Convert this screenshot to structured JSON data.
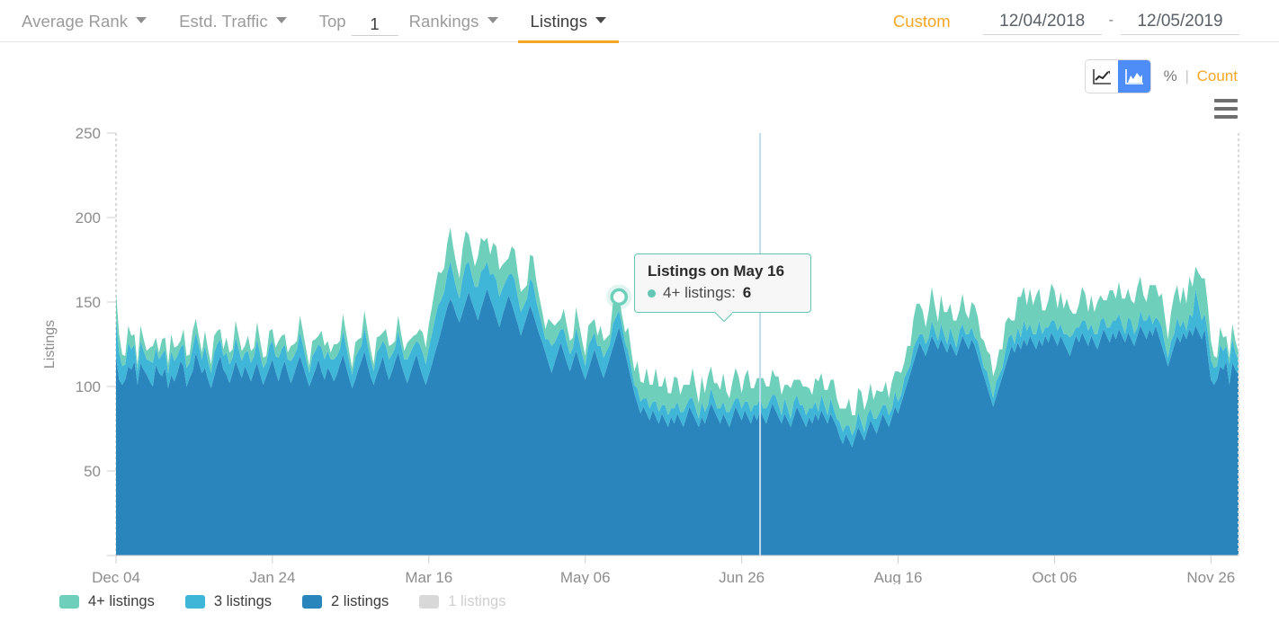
{
  "topbar": {
    "tabs": [
      {
        "label": "Average Rank",
        "active": false
      },
      {
        "label": "Estd. Traffic",
        "active": false
      },
      {
        "label": "Rankings",
        "active": false
      },
      {
        "label": "Listings",
        "active": true
      }
    ],
    "top_prefix": "Top",
    "top_value": "1",
    "custom_label": "Custom",
    "date_start": "12/04/2018",
    "date_separator": "-",
    "date_end": "12/05/2019"
  },
  "controls": {
    "line_icon": "line-chart-icon",
    "area_icon": "area-chart-icon",
    "area_selected": true,
    "percent_label": "%",
    "separator": "|",
    "count_label": "Count",
    "menu_icon": "hamburger-menu-icon"
  },
  "tooltip": {
    "title": "Listings on May 16",
    "series_label": "4+ listings:",
    "value": "6"
  },
  "legend": [
    {
      "label": "4+ listings",
      "color": "#6ecfba",
      "disabled": false
    },
    {
      "label": "3 listings",
      "color": "#3fb5d8",
      "disabled": false
    },
    {
      "label": "2 listings",
      "color": "#2a85bd",
      "disabled": false
    },
    {
      "label": "1 listings",
      "color": "#d8d8d8",
      "disabled": true
    }
  ],
  "chart_data": {
    "type": "area",
    "stacked": true,
    "title": "",
    "xlabel": "",
    "ylabel": "Listings",
    "ylim": [
      0,
      250
    ],
    "yticks": [
      50,
      100,
      150,
      200,
      250
    ],
    "grid": false,
    "legend_position": "bottom-left",
    "x_tick_labels": [
      "Dec 04",
      "Jan 24",
      "Mar 16",
      "May 06",
      "Jun 26",
      "Aug 16",
      "Oct 06",
      "Nov 26"
    ],
    "x_tick_indices": [
      0,
      51,
      102,
      153,
      204,
      255,
      306,
      357
    ],
    "n_points": 367,
    "highlight": {
      "index": 164,
      "label": "May 16",
      "series": "4+ listings",
      "value": 6
    },
    "crosshair_index": 210,
    "series": [
      {
        "name": "2 listings",
        "color": "#2a85bd",
        "values": [
          118,
          104,
          101,
          104,
          112,
          110,
          115,
          101,
          114,
          110,
          107,
          103,
          100,
          113,
          108,
          106,
          111,
          99,
          107,
          103,
          108,
          115,
          112,
          100,
          105,
          109,
          120,
          114,
          108,
          111,
          104,
          99,
          106,
          113,
          118,
          110,
          107,
          102,
          108,
          115,
          110,
          105,
          112,
          108,
          103,
          109,
          114,
          107,
          101,
          106,
          111,
          116,
          109,
          103,
          110,
          115,
          108,
          102,
          107,
          113,
          118,
          112,
          106,
          100,
          105,
          110,
          116,
          109,
          104,
          111,
          108,
          103,
          107,
          113,
          119,
          112,
          105,
          99,
          104,
          110,
          115,
          121,
          113,
          106,
          101,
          107,
          112,
          118,
          110,
          104,
          109,
          115,
          120,
          113,
          107,
          102,
          108,
          114,
          119,
          112,
          106,
          101,
          107,
          113,
          120,
          126,
          133,
          140,
          147,
          152,
          148,
          142,
          138,
          144,
          150,
          156,
          150,
          145,
          139,
          146,
          152,
          158,
          152,
          147,
          141,
          135,
          142,
          148,
          154,
          149,
          143,
          137,
          130,
          136,
          142,
          148,
          143,
          137,
          131,
          126,
          120,
          114,
          108,
          114,
          120,
          126,
          120,
          114,
          109,
          115,
          121,
          115,
          109,
          104,
          110,
          116,
          122,
          116,
          110,
          105,
          111,
          117,
          123,
          129,
          135,
          128,
          120,
          112,
          104,
          96,
          90,
          84,
          88,
          84,
          80,
          86,
          82,
          78,
          84,
          80,
          76,
          82,
          78,
          84,
          80,
          76,
          82,
          88,
          84,
          80,
          76,
          82,
          78,
          84,
          90,
          86,
          82,
          78,
          84,
          80,
          76,
          82,
          88,
          84,
          80,
          86,
          82,
          78,
          84,
          80,
          86,
          82,
          78,
          84,
          90,
          86,
          82,
          78,
          84,
          80,
          76,
          82,
          88,
          84,
          80,
          76,
          82,
          78,
          84,
          80,
          86,
          82,
          78,
          84,
          80,
          76,
          70,
          66,
          72,
          68,
          64,
          70,
          76,
          72,
          68,
          74,
          80,
          76,
          72,
          78,
          84,
          80,
          76,
          82,
          88,
          84,
          90,
          96,
          102,
          108,
          114,
          120,
          126,
          122,
          118,
          124,
          130,
          126,
          122,
          128,
          124,
          120,
          126,
          122,
          118,
          124,
          130,
          126,
          122,
          128,
          124,
          118,
          112,
          106,
          100,
          94,
          88,
          94,
          100,
          106,
          112,
          118,
          124,
          120,
          126,
          122,
          128,
          124,
          130,
          126,
          122,
          128,
          124,
          130,
          126,
          132,
          128,
          124,
          130,
          126,
          122,
          118,
          124,
          130,
          126,
          132,
          128,
          124,
          130,
          126,
          122,
          128,
          134,
          130,
          126,
          132,
          128,
          134,
          130,
          126,
          132,
          128,
          124,
          130,
          136,
          132,
          128,
          134,
          130,
          136,
          130,
          124,
          118,
          112,
          118,
          124,
          130,
          126,
          132,
          128,
          134,
          130,
          136,
          132,
          128,
          134
        ]
      },
      {
        "name": "3 listings",
        "color": "#3fb5d8",
        "values": [
          22,
          16,
          11,
          9,
          14,
          12,
          10,
          8,
          13,
          11,
          9,
          12,
          14,
          10,
          8,
          13,
          11,
          9,
          14,
          12,
          10,
          8,
          13,
          11,
          9,
          14,
          12,
          10,
          8,
          13,
          11,
          9,
          14,
          12,
          10,
          8,
          13,
          11,
          9,
          14,
          12,
          10,
          8,
          13,
          11,
          9,
          14,
          12,
          10,
          8,
          13,
          11,
          9,
          14,
          12,
          10,
          8,
          13,
          11,
          9,
          14,
          12,
          10,
          8,
          13,
          11,
          9,
          14,
          12,
          10,
          8,
          13,
          11,
          9,
          14,
          12,
          10,
          8,
          13,
          11,
          9,
          14,
          12,
          10,
          8,
          13,
          11,
          9,
          14,
          12,
          10,
          8,
          13,
          11,
          9,
          14,
          12,
          10,
          8,
          13,
          14,
          12,
          16,
          18,
          20,
          22,
          18,
          16,
          20,
          22,
          18,
          16,
          14,
          20,
          22,
          18,
          16,
          14,
          20,
          22,
          18,
          16,
          14,
          20,
          22,
          18,
          16,
          14,
          12,
          18,
          20,
          16,
          14,
          12,
          10,
          16,
          18,
          14,
          12,
          10,
          8,
          14,
          16,
          12,
          10,
          8,
          14,
          12,
          10,
          8,
          14,
          12,
          10,
          8,
          14,
          12,
          10,
          8,
          14,
          12,
          10,
          8,
          14,
          12,
          10,
          8,
          6,
          9,
          7,
          5,
          9,
          7,
          5,
          9,
          7,
          5,
          9,
          7,
          5,
          9,
          7,
          5,
          9,
          7,
          5,
          9,
          7,
          5,
          9,
          7,
          5,
          9,
          7,
          5,
          9,
          7,
          5,
          9,
          7,
          5,
          9,
          7,
          5,
          9,
          7,
          5,
          9,
          7,
          5,
          9,
          7,
          5,
          9,
          7,
          5,
          9,
          7,
          5,
          9,
          7,
          5,
          9,
          7,
          5,
          9,
          7,
          5,
          9,
          7,
          5,
          9,
          7,
          5,
          9,
          7,
          5,
          9,
          7,
          5,
          9,
          7,
          5,
          9,
          7,
          5,
          9,
          7,
          5,
          9,
          7,
          5,
          9,
          7,
          5,
          9,
          7,
          5,
          9,
          7,
          5,
          9,
          7,
          5,
          9,
          7,
          5,
          9,
          7,
          5,
          9,
          7,
          5,
          9,
          7,
          5,
          9,
          7,
          5,
          9,
          7,
          5,
          9,
          7,
          5,
          9,
          7,
          5,
          9,
          7,
          5,
          9,
          11,
          7,
          5,
          9,
          7,
          11,
          9,
          7,
          5,
          9,
          11,
          7,
          5,
          9,
          7,
          11,
          9,
          7,
          5,
          9,
          11,
          7,
          5,
          9,
          7,
          11,
          9,
          7,
          5,
          9,
          11,
          7,
          5,
          9,
          7,
          11,
          9,
          7,
          5,
          9,
          11,
          7,
          5,
          9,
          7,
          11,
          9,
          7,
          5,
          9,
          11,
          7,
          5,
          9,
          7,
          11,
          9,
          7,
          5,
          9,
          11
        ]
      },
      {
        "name": "4+ listings",
        "color": "#6ecfba",
        "values": [
          16,
          11,
          7,
          5,
          10,
          8,
          6,
          4,
          9,
          7,
          5,
          8,
          10,
          6,
          4,
          9,
          7,
          5,
          10,
          8,
          6,
          4,
          9,
          7,
          5,
          10,
          8,
          6,
          4,
          9,
          7,
          5,
          10,
          8,
          6,
          4,
          9,
          7,
          5,
          10,
          8,
          6,
          4,
          9,
          7,
          5,
          10,
          8,
          6,
          4,
          9,
          7,
          5,
          10,
          8,
          6,
          4,
          9,
          7,
          5,
          10,
          8,
          6,
          4,
          9,
          7,
          5,
          10,
          8,
          6,
          4,
          9,
          7,
          5,
          10,
          8,
          6,
          4,
          9,
          7,
          5,
          10,
          8,
          6,
          4,
          9,
          7,
          5,
          10,
          8,
          6,
          4,
          9,
          7,
          5,
          10,
          8,
          6,
          4,
          9,
          12,
          10,
          14,
          16,
          18,
          20,
          16,
          14,
          18,
          20,
          16,
          14,
          12,
          18,
          20,
          16,
          14,
          12,
          18,
          20,
          16,
          14,
          12,
          18,
          20,
          16,
          14,
          12,
          10,
          16,
          18,
          14,
          12,
          10,
          8,
          14,
          16,
          12,
          10,
          8,
          6,
          12,
          14,
          10,
          8,
          6,
          12,
          10,
          8,
          6,
          12,
          10,
          8,
          6,
          12,
          10,
          8,
          6,
          12,
          10,
          8,
          6,
          12,
          10,
          8,
          6,
          6,
          14,
          10,
          8,
          16,
          12,
          9,
          18,
          14,
          10,
          20,
          15,
          11,
          17,
          13,
          9,
          19,
          14,
          10,
          16,
          12,
          8,
          18,
          13,
          9,
          15,
          11,
          17,
          13,
          9,
          15,
          11,
          17,
          12,
          8,
          14,
          18,
          13,
          9,
          15,
          19,
          14,
          10,
          16,
          12,
          18,
          13,
          9,
          15,
          11,
          17,
          12,
          8,
          14,
          18,
          13,
          9,
          15,
          11,
          17,
          12,
          8,
          14,
          18,
          13,
          9,
          15,
          11,
          17,
          12,
          8,
          14,
          10,
          16,
          12,
          8,
          14,
          18,
          13,
          9,
          15,
          11,
          17,
          12,
          8,
          14,
          10,
          16,
          12,
          18,
          13,
          9,
          15,
          11,
          17,
          22,
          18,
          14,
          10,
          16,
          20,
          15,
          11,
          17,
          13,
          19,
          14,
          10,
          16,
          12,
          18,
          13,
          9,
          15,
          19,
          14,
          10,
          16,
          12,
          18,
          13,
          9,
          15,
          11,
          17,
          12,
          8,
          14,
          18,
          24,
          20,
          15,
          21,
          17,
          23,
          19,
          14,
          10,
          16,
          22,
          18,
          13,
          19,
          15,
          21,
          17,
          12,
          8,
          14,
          20,
          16,
          11,
          17,
          13,
          19,
          15,
          10,
          16,
          22,
          18,
          13,
          19,
          15,
          21,
          17,
          12,
          18,
          24,
          20,
          15,
          11,
          17,
          23,
          19,
          14,
          20,
          16,
          11,
          17,
          23,
          19,
          14,
          20,
          16,
          22,
          18,
          13,
          19,
          25,
          21
        ]
      }
    ]
  }
}
